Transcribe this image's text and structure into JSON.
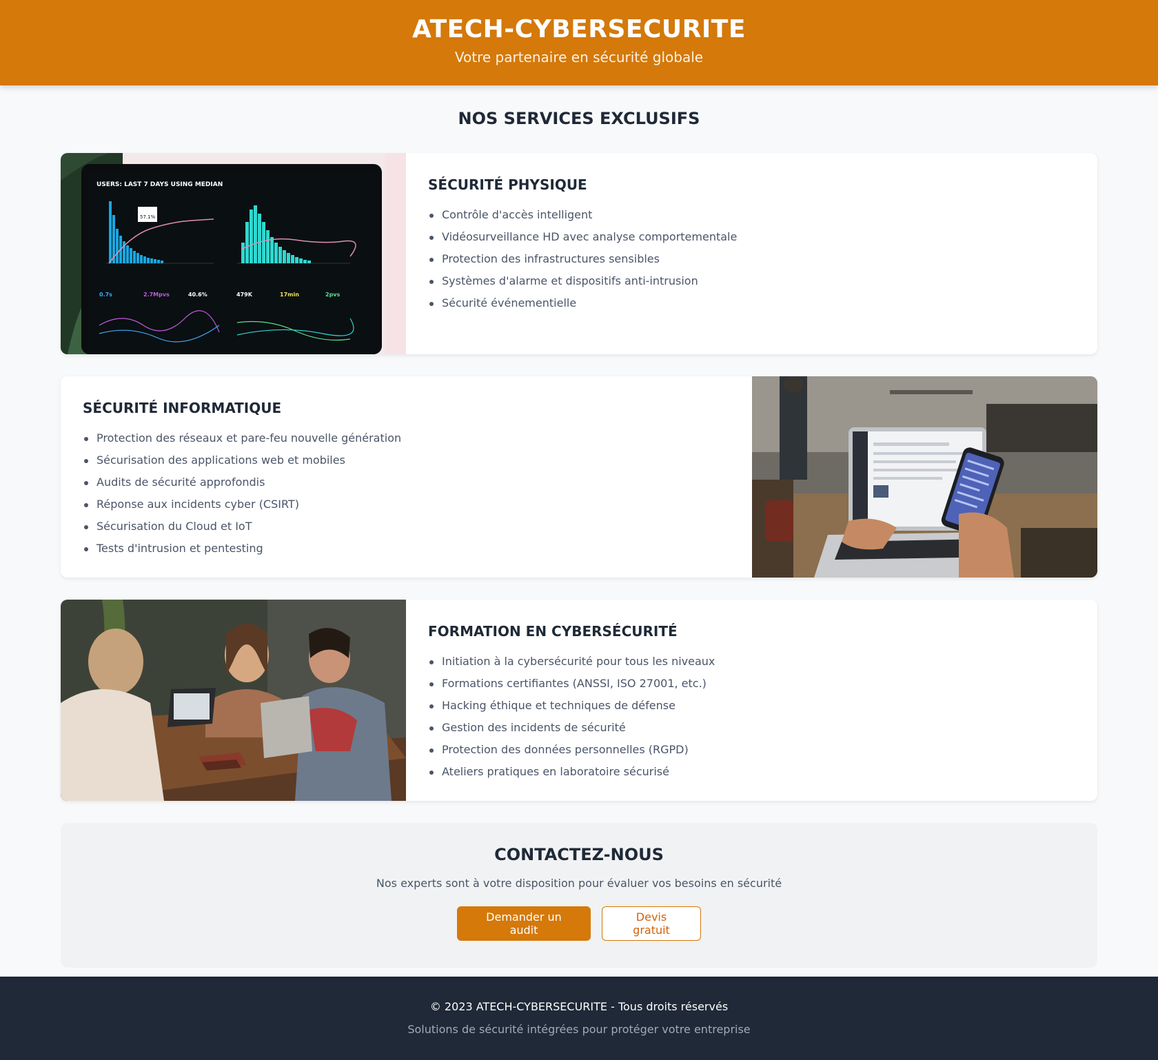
{
  "header": {
    "title": "ATECH-CYBERSECURITE",
    "subtitle": "Votre partenaire en sécurité globale",
    "color": "#d4790a"
  },
  "services_title": "NOS SERVICES EXCLUSIFS",
  "services": [
    {
      "title": "SÉCURITÉ PHYSIQUE",
      "image": "laptop-analytics-dashboard-photo",
      "image_text": {
        "heading": "USERS: LAST 7 DAYS USING MEDIAN",
        "tooltip": "57.1%",
        "metrics": [
          "0.7s",
          "2.7Mpvs",
          "40.6%",
          "479K",
          "17min",
          "2pvs"
        ]
      },
      "items": [
        "Contrôle d'accès intelligent",
        "Vidéosurveillance HD avec analyse comportementale",
        "Protection des infrastructures sensibles",
        "Systèmes d'alarme et dispositifs anti-intrusion",
        "Sécurité événementielle"
      ]
    },
    {
      "title": "SÉCURITÉ INFORMATIQUE",
      "image": "person-laptop-smartphone-photo",
      "items": [
        "Protection des réseaux et pare-feu nouvelle génération",
        "Sécurisation des applications web et mobiles",
        "Audits de sécurité approfondis",
        "Réponse aux incidents cyber (CSIRT)",
        "Sécurisation du Cloud et IoT",
        "Tests d'intrusion et pentesting"
      ]
    },
    {
      "title": "FORMATION EN CYBERSÉCURITÉ",
      "image": "team-laptops-meeting-photo",
      "items": [
        "Initiation à la cybersécurité pour tous les niveaux",
        "Formations certifiantes (ANSSI, ISO 27001, etc.)",
        "Hacking éthique et techniques de défense",
        "Gestion des incidents de sécurité",
        "Protection des données personnelles (RGPD)",
        "Ateliers pratiques en laboratoire sécurisé"
      ]
    }
  ],
  "contact": {
    "title": "CONTACTEZ-NOUS",
    "text": "Nos experts sont à votre disposition pour évaluer vos besoins en sécurité",
    "primary_label": "Demander un audit",
    "secondary_label": "Devis gratuit"
  },
  "footer": {
    "copyright": "© 2023 ATECH-CYBERSECURITE - Tous droits réservés",
    "tagline": "Solutions de sécurité intégrées pour protéger votre entreprise"
  }
}
